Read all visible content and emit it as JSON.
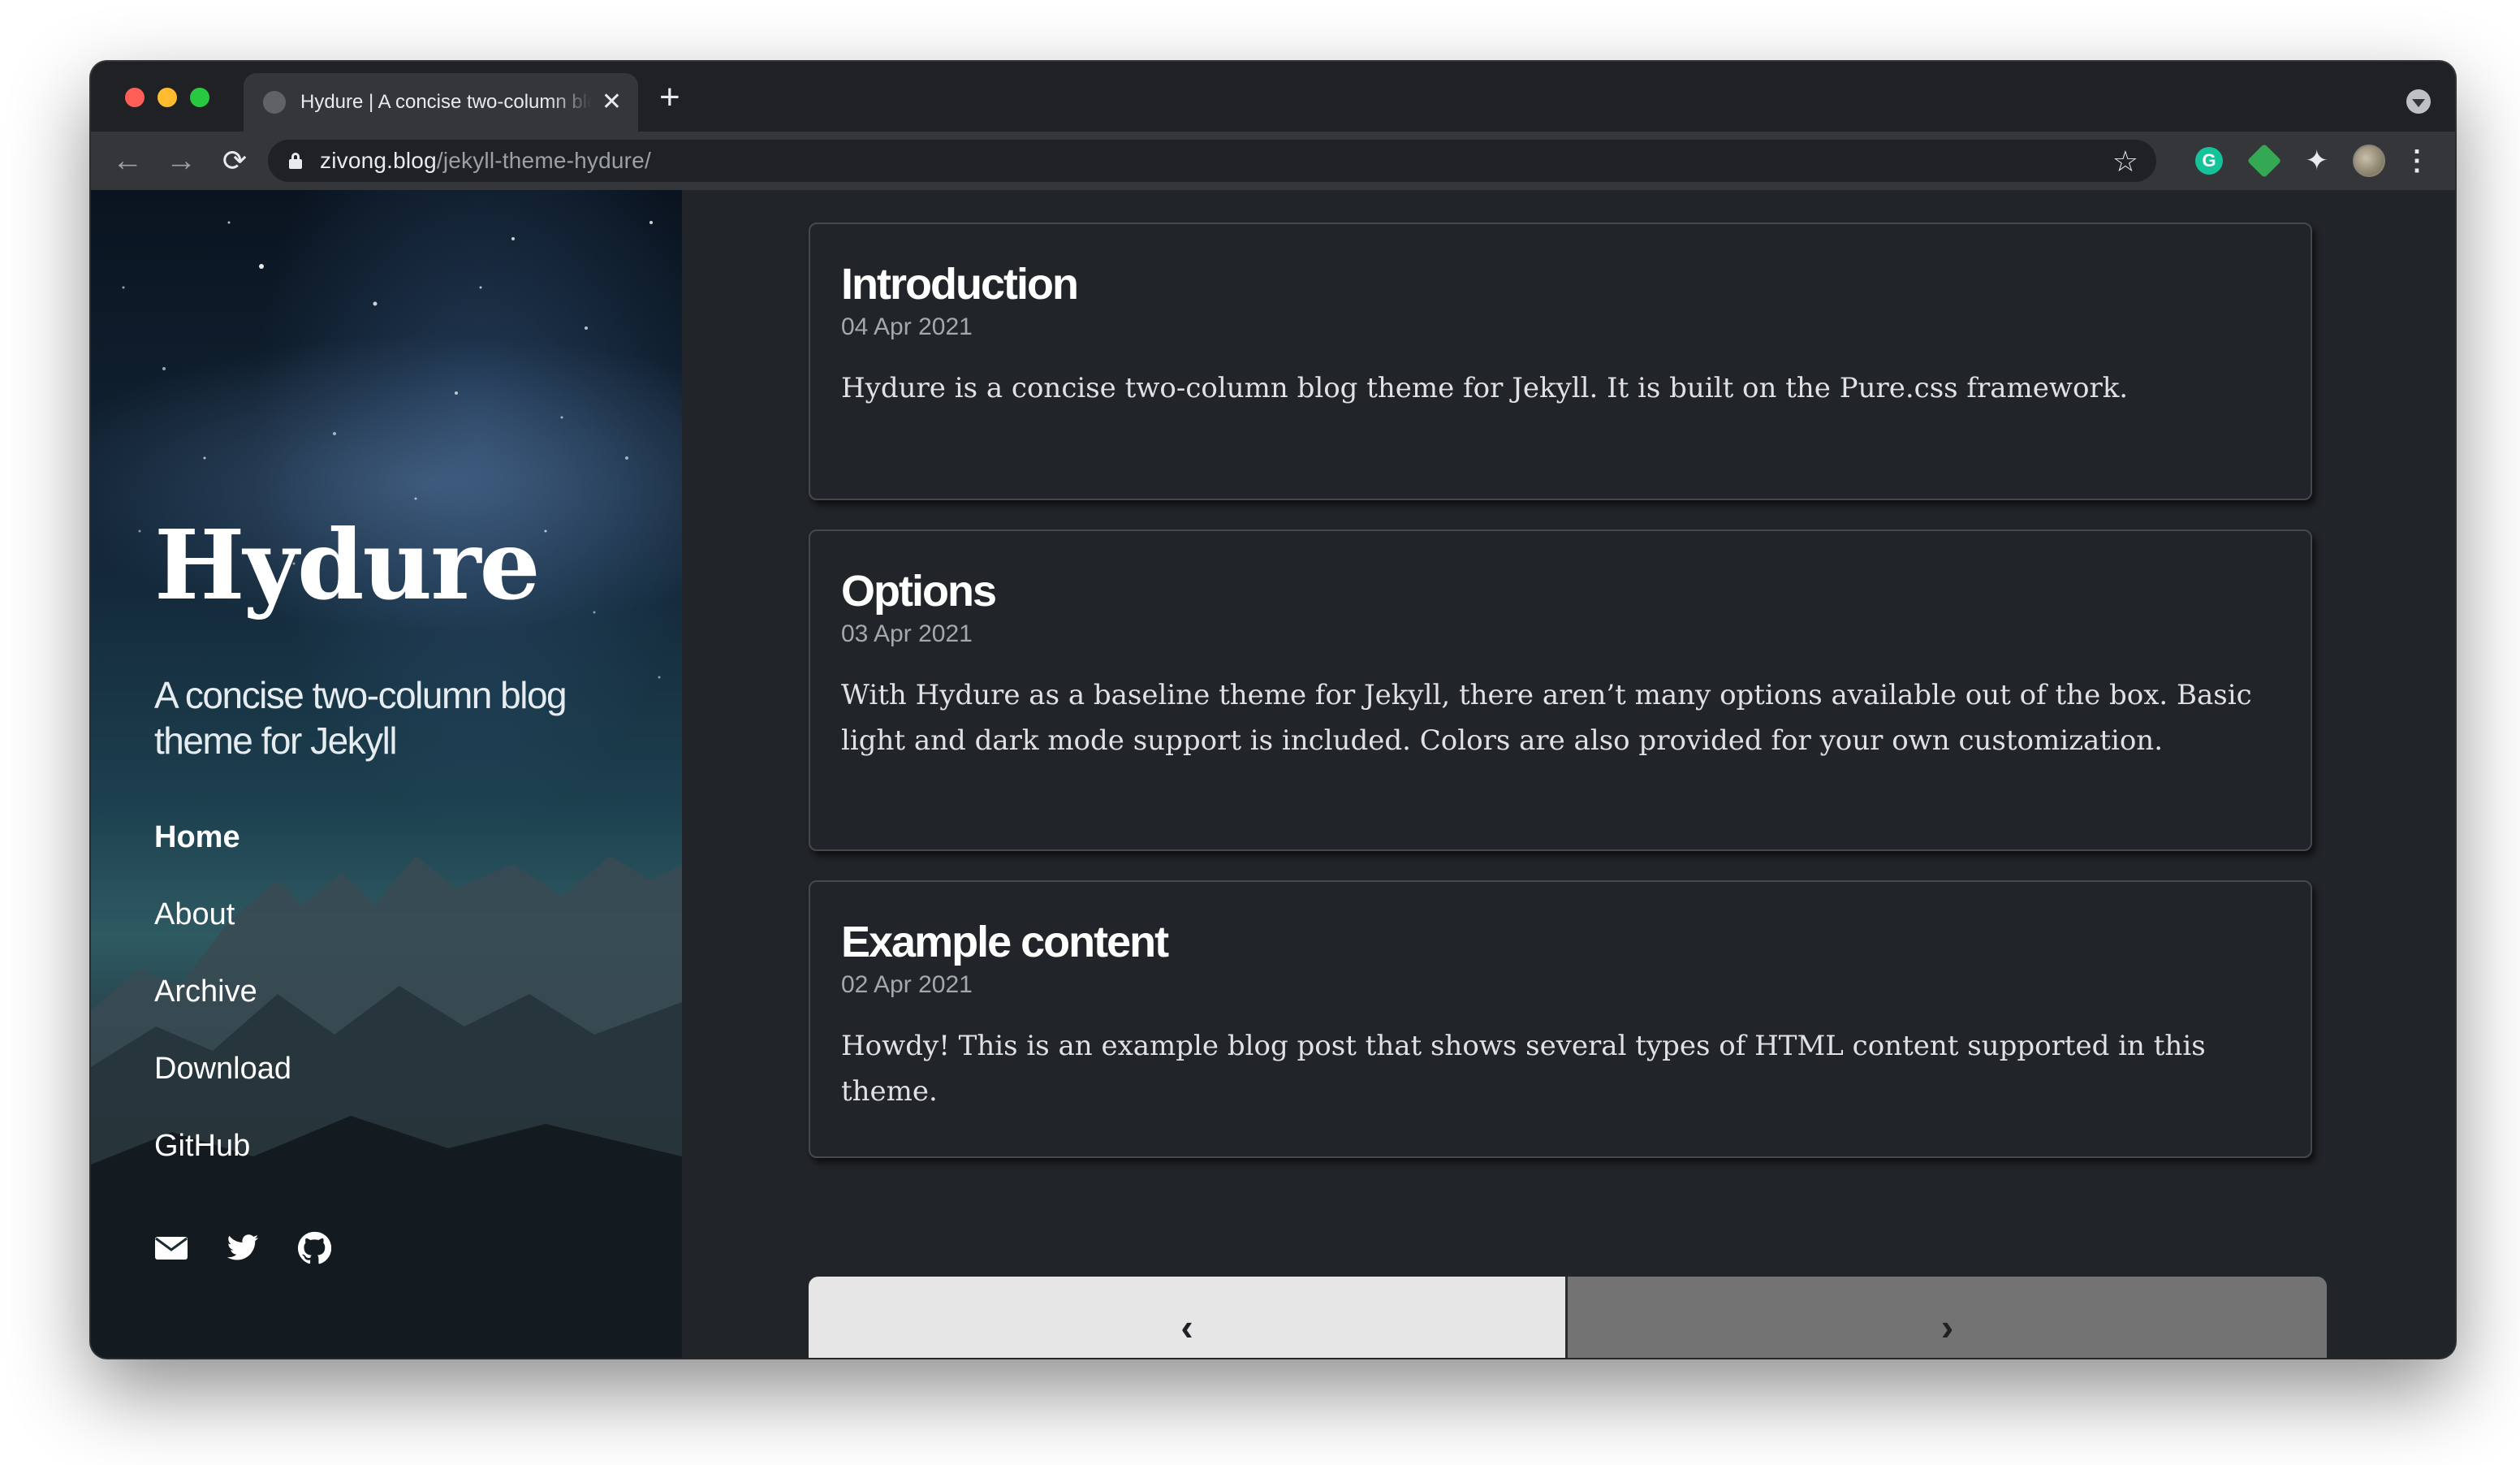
{
  "browser": {
    "tab_title": "Hydure | A concise two-column blog theme for Jekyll",
    "tab_close": "✕",
    "new_tab": "+",
    "url_host": "zivong.blog",
    "url_path": "/jekyll-theme-hydure/",
    "back": "←",
    "forward": "→",
    "reload": "⟳",
    "star": "☆",
    "puzzle": "✦",
    "menu": "⋮",
    "grammarly": "G"
  },
  "sidebar": {
    "title": "Hydure",
    "tagline": "A concise two-column blog theme for Jekyll",
    "nav": [
      {
        "label": "Home",
        "active": true
      },
      {
        "label": "About"
      },
      {
        "label": "Archive"
      },
      {
        "label": "Download"
      },
      {
        "label": "GitHub"
      }
    ],
    "social": [
      "envelope-icon",
      "twitter-icon",
      "github-icon"
    ]
  },
  "posts": [
    {
      "title": "Introduction",
      "date": "04 Apr 2021",
      "excerpt": "Hydure is a concise two-column blog theme for Jekyll. It is built on the Pure.css framework."
    },
    {
      "title": "Options",
      "date": "03 Apr 2021",
      "excerpt": "With Hydure as a baseline theme for Jekyll, there aren’t many options available out of the box. Basic light and dark mode support is included. Colors are also provided for your own customization."
    },
    {
      "title": "Example content",
      "date": "02 Apr 2021",
      "excerpt": "Howdy! This is an example blog post that shows several types of HTML content supported in this theme."
    }
  ],
  "pager": {
    "prev": "‹",
    "next": "›"
  },
  "colors": {
    "page_bg": "#212428",
    "card_border": "#45484d",
    "pager_prev_bg": "#e6e6e6",
    "pager_next_bg": "#737373"
  }
}
